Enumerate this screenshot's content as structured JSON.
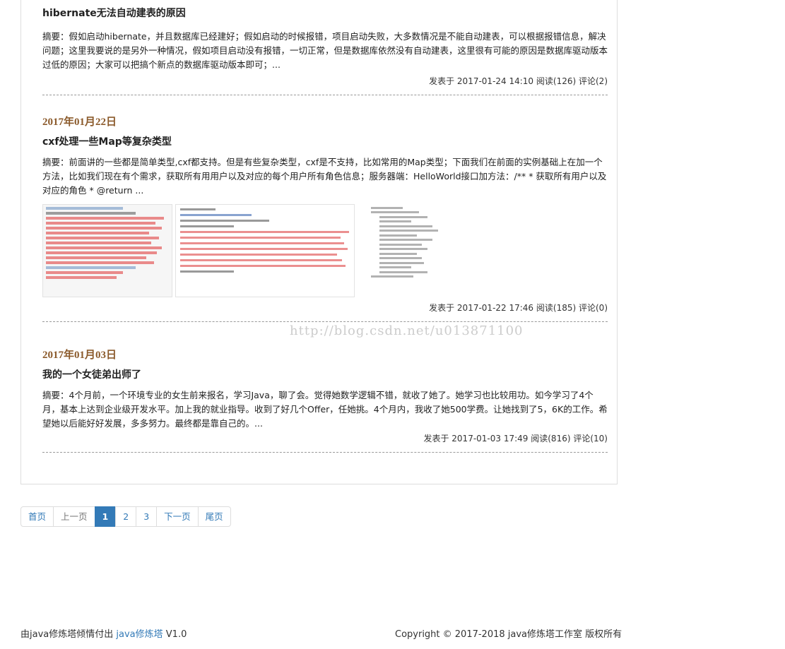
{
  "posts": [
    {
      "date": "",
      "title": "hibernate无法自动建表的原因",
      "summary": "摘要：假如启动hibernate，并且数据库已经建好；假如启动的时候报错，项目启动失败，大多数情况是不能自动建表，可以根据报错信息，解决问题；这里我要说的是另外一种情况，假如项目启动没有报错，一切正常，但是数据库依然没有自动建表，这里很有可能的原因是数据库驱动版本过低的原因；大家可以把搞个新点的数据库驱动版本即可；...",
      "published": "发表于 2017-01-24 14:10",
      "reads": "阅读(126)",
      "comments": "评论(2)"
    },
    {
      "date": "2017年01月22日",
      "title": "cxf处理一些Map等复杂类型",
      "summary": "摘要：前面讲的一些都是简单类型,cxf都支持。但是有些复杂类型，cxf是不支持，比如常用的Map类型；下面我们在前面的实例基础上在加一个方法，比如我们现在有个需求，获取所有用用户以及对应的每个用户所有角色信息；服务器端：HelloWorld接口加方法：/** * 获取所有用户以及对应的角色 * @return ...",
      "published": "发表于 2017-01-22 17:46",
      "reads": "阅读(185)",
      "comments": "评论(0)"
    },
    {
      "date": "2017年01月03日",
      "title": "我的一个女徒弟出师了",
      "summary": "摘要：4个月前，一个环境专业的女生前来报名，学习Java，聊了会。觉得她数学逻辑不错，就收了她了。她学习也比较用功。如今学习了4个月，基本上达到企业级开发水平。加上我的就业指导。收到了好几个Offer，任她挑。4个月内，我收了她500学费。让她找到了5，6K的工作。希望她以后能好好发展，多多努力。最终都是靠自己的。...",
      "published": "发表于 2017-01-03 17:49",
      "reads": "阅读(816)",
      "comments": "评论(10)"
    }
  ],
  "watermark": "http://blog.csdn.net/u013871100",
  "pagination": {
    "first": "首页",
    "prev": "上一页",
    "pages": [
      "1",
      "2",
      "3"
    ],
    "active_page": "1",
    "next": "下一页",
    "last": "尾页"
  },
  "footer": {
    "left_prefix": "由java修炼塔倾情付出",
    "left_link": "java修炼塔",
    "version": "V1.0",
    "copyright": "Copyright © 2017-2018 java修炼塔工作室 版权所有"
  },
  "colors": {
    "date": "#8b5a2b",
    "link": "#337ab7",
    "active": "#337ab7"
  }
}
